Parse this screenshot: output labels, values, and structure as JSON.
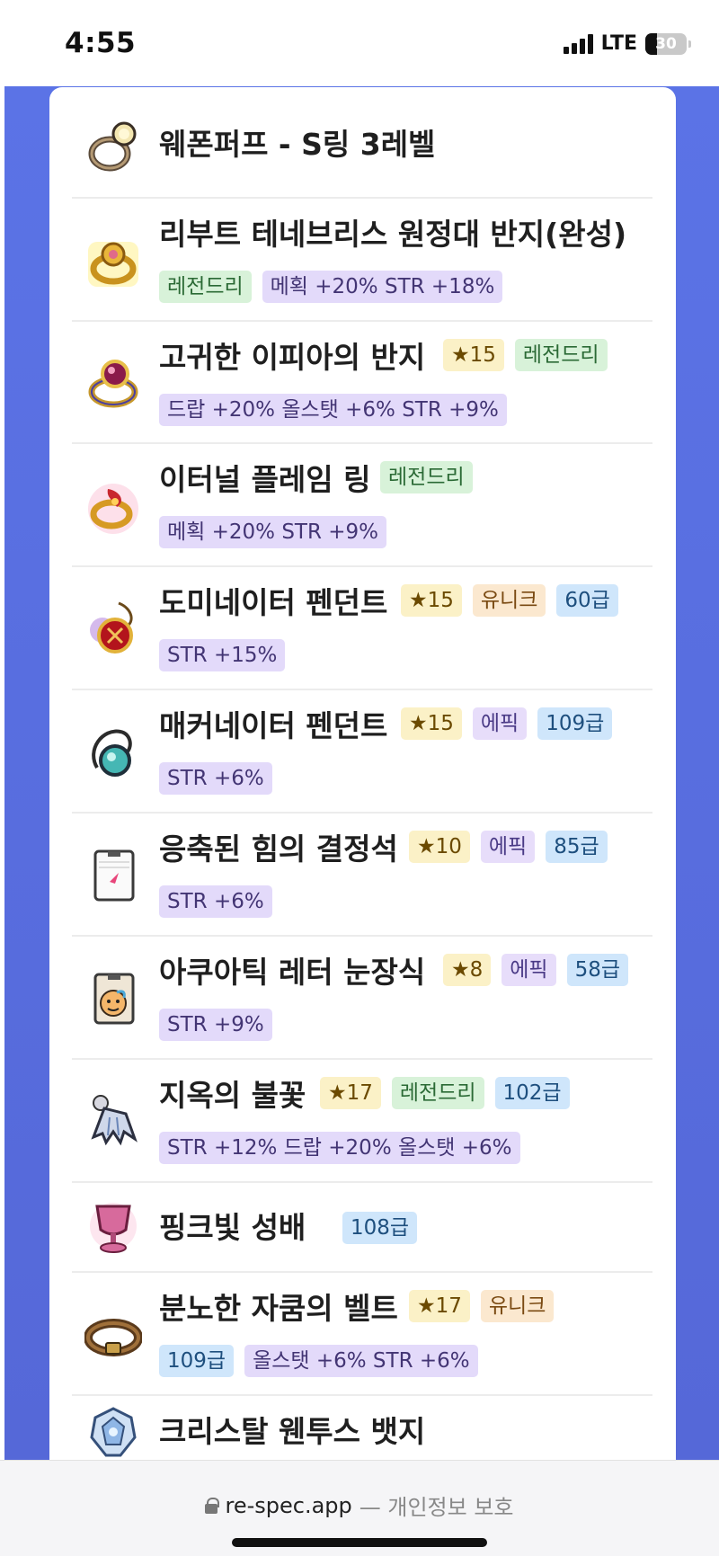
{
  "status": {
    "time": "4:55",
    "network": "LTE",
    "battery": "30"
  },
  "items": [
    {
      "name": "웨폰퍼프 - S링 3레벨",
      "badges": [],
      "options": []
    },
    {
      "name": "리부트 테네브리스 원정대 반지(완성)",
      "badges": [],
      "options": [
        "레전드리",
        "메획 +20% STR +18%"
      ]
    },
    {
      "name": "고귀한 이피아의 반지",
      "badges": [
        "★15",
        "레전드리"
      ],
      "options": [
        "드랍 +20% 올스탯 +6% STR +9%"
      ]
    },
    {
      "name": "이터널 플레임 링",
      "badges": [
        "레전드리"
      ],
      "options": [
        "메획 +20% STR +9%"
      ]
    },
    {
      "name": "도미네이터 펜던트",
      "badges": [
        "★15",
        "유니크",
        "60급"
      ],
      "options": [
        "STR +15%"
      ]
    },
    {
      "name": "매커네이터 펜던트",
      "badges": [
        "★15",
        "에픽",
        "109급"
      ],
      "options": [
        "STR +6%"
      ]
    },
    {
      "name": "응축된 힘의 결정석",
      "badges": [
        "★10",
        "에픽",
        "85급"
      ],
      "options": [
        "STR +6%"
      ]
    },
    {
      "name": "아쿠아틱 레터 눈장식",
      "badges": [
        "★8",
        "에픽",
        "58급"
      ],
      "options": [
        "STR +9%"
      ]
    },
    {
      "name": "지옥의 불꽃",
      "badges": [
        "★17",
        "레전드리",
        "102급"
      ],
      "options": [
        "STR +12% 드랍 +20% 올스탯 +6%"
      ]
    },
    {
      "name": "핑크빛 성배",
      "badges": [
        "108급"
      ],
      "options": []
    },
    {
      "name": "분노한 자쿰의 벨트",
      "badges": [
        "★17",
        "유니크"
      ],
      "options": [
        "109급",
        "올스탯 +6% STR +6%"
      ]
    },
    {
      "name": "크리스탈 웬투스 뱃지",
      "badges": [],
      "options": []
    }
  ],
  "icons": [
    "ring-icon",
    "gold-ring-icon",
    "ifia-ring-icon",
    "flame-ring-icon",
    "dominator-pendant-icon",
    "mechanator-pendant-icon",
    "crystal-pocket-icon",
    "aquatic-letter-icon",
    "hell-flame-icon",
    "pink-chalice-icon",
    "zakum-belt-icon",
    "crystal-badge-icon"
  ],
  "browser": {
    "url": "re-spec.app",
    "privacy": "— 개인정보 보호"
  }
}
